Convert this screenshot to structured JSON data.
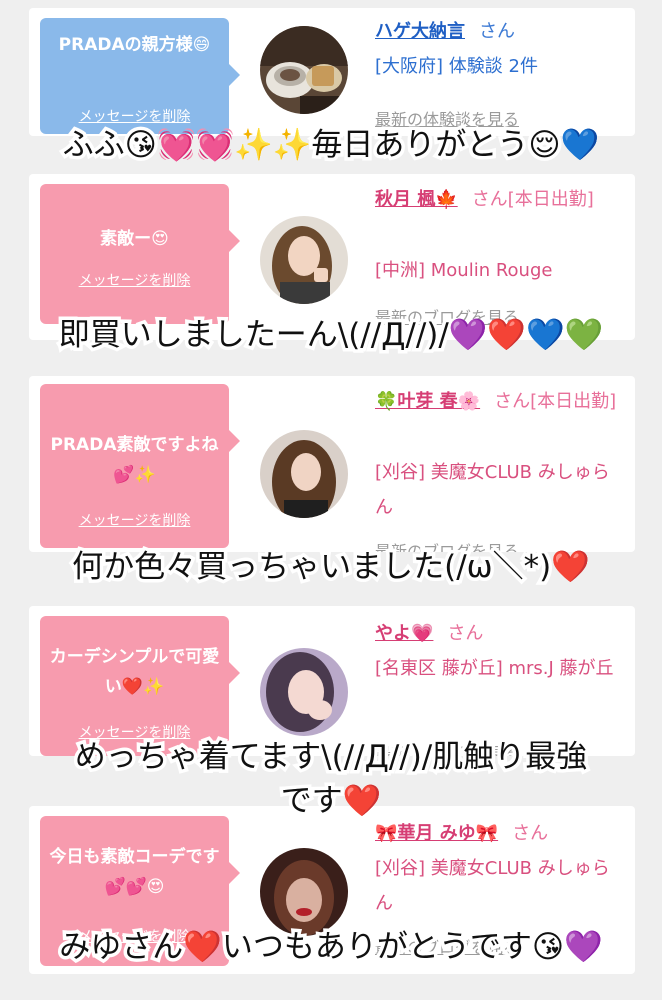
{
  "cards": [
    {
      "message": "PRADAの親方様😄",
      "delete_label": "メッセージを削除",
      "name": "ハゲ大納言",
      "honorific": "さん",
      "detail": "[大阪府] 体験談 2件",
      "link": "最新の体験談を見る",
      "bubble_color": "#8ab9ea",
      "avatar_icon": "coffee-photo"
    },
    {
      "message": "素敵ー😍",
      "delete_label": "メッセージを削除",
      "name": "秋月 楓🍁",
      "honorific": "さん[本日出勤]",
      "detail": "[中洲] Moulin Rouge",
      "link": "最新のブログを見る",
      "bubble_color": "#f79bae",
      "avatar_icon": "woman-photo"
    },
    {
      "message": "PRADA素敵ですよね💕✨",
      "delete_label": "メッセージを削除",
      "name": "🍀叶芽 春🌸",
      "honorific": "さん[本日出勤]",
      "detail": "[刈谷] 美魔女CLUB みしゅらん",
      "link": "最新のブログを見る",
      "bubble_color": "#f79bae",
      "avatar_icon": "woman-photo"
    },
    {
      "message": "カーデシンプルで可愛い❤️✨",
      "delete_label": "メッセージを削除",
      "name": "やよ💗",
      "honorific": "さん",
      "detail": "[名東区 藤が丘] mrs.J 藤が丘",
      "link": "最新のブログを見る",
      "bubble_color": "#f79bae",
      "avatar_icon": "woman-photo"
    },
    {
      "message": "今日も素敵コーデです💕💕😍",
      "delete_label": "メッセージを削除",
      "name": "🎀華月 みゆ🎀",
      "honorific": "さん",
      "detail": "[刈谷] 美魔女CLUB みしゅらん",
      "link": "最新のブログを見る",
      "bubble_color": "#f79bae",
      "avatar_icon": "woman-photo"
    }
  ],
  "captions": [
    "ふふ😘💓💓✨✨毎日ありがとう😌💙",
    "即買いしましたーん\\(//Д//)/💜❤️💙💚",
    "何か色々買っちゃいました(/ω＼*)❤️",
    "めっちゃ着てます\\(//Д//)/肌触り最強",
    "です❤️",
    "みゆさん❤️いつもありがとうです😘💜"
  ]
}
